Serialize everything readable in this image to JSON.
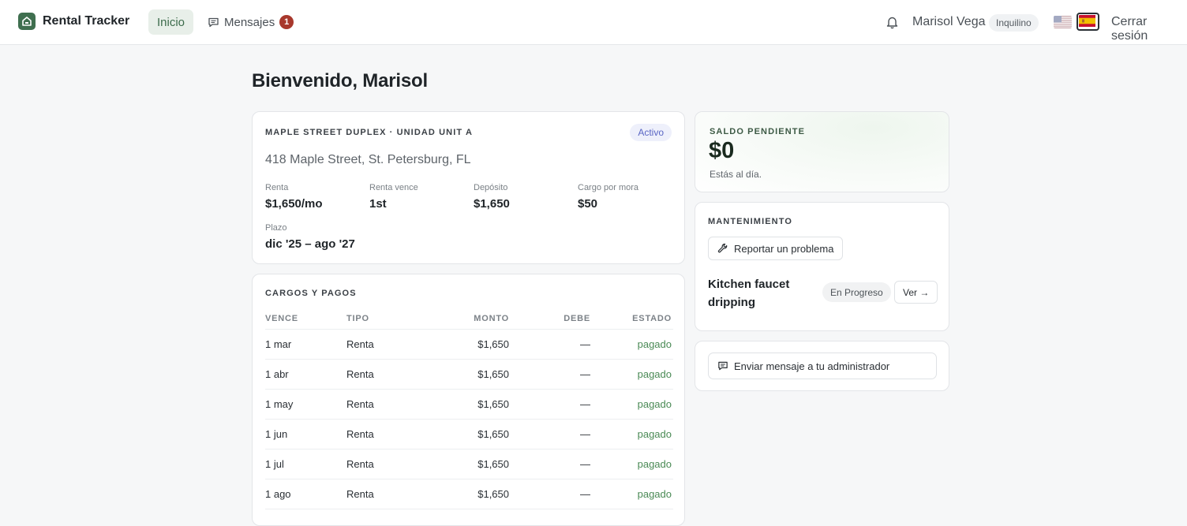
{
  "app": {
    "name": "Rental Tracker"
  },
  "nav": {
    "home_label": "Inicio",
    "messages_label": "Mensajes",
    "messages_badge": "1"
  },
  "user": {
    "name": "Marisol Vega",
    "role": "Inquilino",
    "logout_label": "Cerrar sesión",
    "languages": [
      "en",
      "es"
    ],
    "active_language": "es"
  },
  "page": {
    "title": "Bienvenido, Marisol"
  },
  "property": {
    "heading": "MAPLE STREET DUPLEX · UNIDAD UNIT A",
    "status": "Activo",
    "address": "418 Maple Street, St. Petersburg, FL",
    "fields": [
      {
        "label": "Renta",
        "value": "$1,650/mo"
      },
      {
        "label": "Renta vence",
        "value": "1st"
      },
      {
        "label": "Depósito",
        "value": "$1,650"
      },
      {
        "label": "Cargo por mora",
        "value": "$50"
      },
      {
        "label": "Plazo",
        "value": "dic '25 – ago '27"
      }
    ]
  },
  "charges": {
    "heading": "CARGOS Y PAGOS",
    "columns": {
      "due": "VENCE",
      "type": "TIPO",
      "amount": "MONTO",
      "owed": "DEBE",
      "status": "ESTADO"
    },
    "rows": [
      {
        "due": "1 mar",
        "type": "Renta",
        "amount": "$1,650",
        "owed": "—",
        "status": "pagado"
      },
      {
        "due": "1 abr",
        "type": "Renta",
        "amount": "$1,650",
        "owed": "—",
        "status": "pagado"
      },
      {
        "due": "1 may",
        "type": "Renta",
        "amount": "$1,650",
        "owed": "—",
        "status": "pagado"
      },
      {
        "due": "1 jun",
        "type": "Renta",
        "amount": "$1,650",
        "owed": "—",
        "status": "pagado"
      },
      {
        "due": "1 jul",
        "type": "Renta",
        "amount": "$1,650",
        "owed": "—",
        "status": "pagado"
      },
      {
        "due": "1 ago",
        "type": "Renta",
        "amount": "$1,650",
        "owed": "—",
        "status": "pagado"
      }
    ]
  },
  "balance": {
    "heading": "SALDO PENDIENTE",
    "amount": "$0",
    "note": "Estás al día."
  },
  "maintenance": {
    "heading": "MANTENIMIENTO",
    "report_label": "Reportar un problema",
    "issue_title": "Kitchen faucet dripping",
    "issue_status": "En Progreso",
    "view_label": "Ver →"
  },
  "contact": {
    "message_label": "Enviar mensaje a tu administrador"
  },
  "colors": {
    "brand": "#3f6f4f",
    "paid": "#4a8a55",
    "badge": "#a8382c",
    "active_pill": "#5a66c4"
  }
}
